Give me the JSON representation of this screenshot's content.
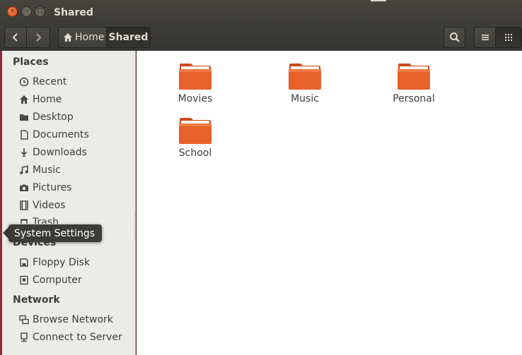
{
  "window": {
    "title": "Shared"
  },
  "titlebar_buttons": {
    "close": "×",
    "minimize": "−",
    "maximize": "□"
  },
  "toolbar": {
    "back_icon": "‹",
    "forward_icon": "›",
    "breadcrumbs": [
      {
        "label": "Home",
        "icon": "home-icon"
      },
      {
        "label": "Shared"
      }
    ],
    "search_icon": "search-icon",
    "list_view_icon": "list-icon",
    "grid_view_icon": "grid-icon"
  },
  "sidebar": {
    "places_heading": "Places",
    "places": [
      {
        "label": "Recent",
        "icon": "clock-icon"
      },
      {
        "label": "Home",
        "icon": "home-icon"
      },
      {
        "label": "Desktop",
        "icon": "desktop-folder-icon"
      },
      {
        "label": "Documents",
        "icon": "document-icon"
      },
      {
        "label": "Downloads",
        "icon": "download-icon"
      },
      {
        "label": "Music",
        "icon": "music-icon"
      },
      {
        "label": "Pictures",
        "icon": "camera-icon"
      },
      {
        "label": "Videos",
        "icon": "film-icon"
      },
      {
        "label": "Trash",
        "icon": "trash-icon"
      }
    ],
    "devices_heading": "Devices",
    "devices": [
      {
        "label": "Floppy Disk",
        "icon": "floppy-icon"
      },
      {
        "label": "Computer",
        "icon": "drive-icon"
      }
    ],
    "network_heading": "Network",
    "network": [
      {
        "label": "Browse Network",
        "icon": "network-icon"
      },
      {
        "label": "Connect to Server",
        "icon": "server-icon"
      }
    ]
  },
  "files": [
    {
      "name": "Movies"
    },
    {
      "name": "Music"
    },
    {
      "name": "Personal"
    },
    {
      "name": "School"
    }
  ],
  "tooltip": {
    "text": "System Settings"
  },
  "colors": {
    "folder_orange": "#e8602a",
    "accent": "#dd4814"
  }
}
